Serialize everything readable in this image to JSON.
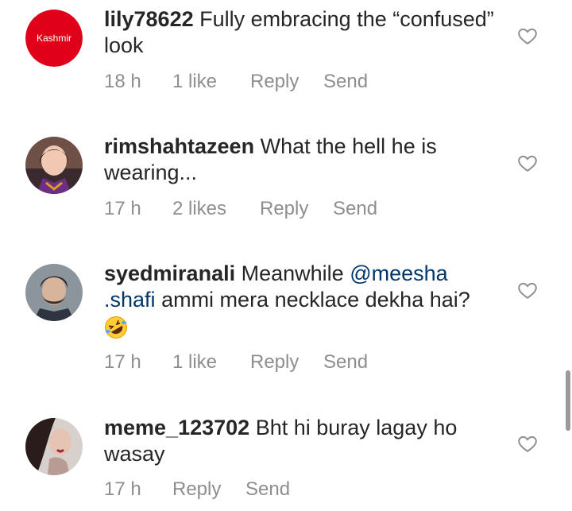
{
  "comments": [
    {
      "username": "lily78622",
      "text": "Fully embracing the “confused” look",
      "avatar_label": "Kashmir",
      "time": "18 h",
      "likes": "1 like",
      "reply": "Reply",
      "send": "Send"
    },
    {
      "username": "rimshahtazeen",
      "text": "What the hell he is wearing...",
      "time": "17 h",
      "likes": "2 likes",
      "reply": "Reply",
      "send": "Send"
    },
    {
      "username": "syedmiranali",
      "text_before": "Meanwhile",
      "mention": "@meesha .shafi",
      "text_after": "ammi mera necklace dekha hai?",
      "time": "17 h",
      "likes": "1 like",
      "reply": "Reply",
      "send": "Send"
    },
    {
      "username": "meme_123702",
      "text": "Bht hi buray lagay ho wasay",
      "time": "17 h",
      "reply": "Reply",
      "send": "Send"
    }
  ],
  "icons": {
    "like": "heart-outline-icon",
    "emoji": "rolling-on-floor-laughing-emoji"
  },
  "colors": {
    "text": "#262626",
    "meta": "#8e8e8e",
    "mention": "#00376b",
    "kashmir_avatar": "#e0001a"
  }
}
